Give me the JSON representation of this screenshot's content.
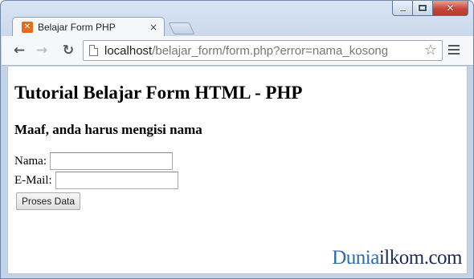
{
  "browser": {
    "tab_title": "Belajar Form PHP",
    "tab_favicon": "xampp-icon",
    "tab_close": "×",
    "url_host": "localhost",
    "url_path": "/belajar_form/form.php?error=nama_kosong",
    "nav_icons": {
      "back": "←",
      "forward": "→",
      "reload": "↻",
      "star": "☆"
    },
    "window_close": "✕"
  },
  "page": {
    "heading": "Tutorial Belajar Form HTML - PHP",
    "error_message": "Maaf, anda harus mengisi nama",
    "form": {
      "nama_label": "Nama:",
      "nama_value": "",
      "email_label": "E-Mail:",
      "email_value": "",
      "submit_label": "Proses Data"
    },
    "watermark_part1": "Dunia",
    "watermark_part2": "ilkom.com"
  },
  "colors": {
    "favicon": "#e86a1e",
    "watermark_part1": "#2a6cb0",
    "watermark_part2": "#1c2c55",
    "close_button": "#c7483a"
  }
}
